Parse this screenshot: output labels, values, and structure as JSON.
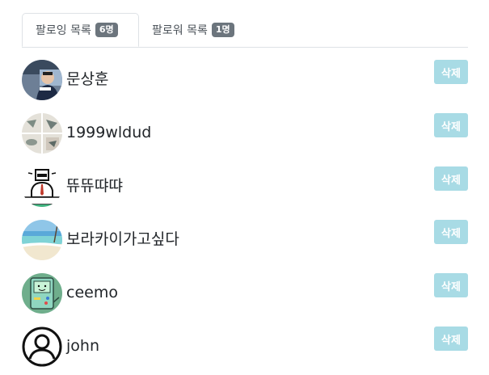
{
  "tabs": [
    {
      "label": "팔로잉 목록",
      "count": "6명"
    },
    {
      "label": "팔로워 목록",
      "count": "1명"
    }
  ],
  "users": [
    {
      "name": "문상훈",
      "avatar": "person-photo",
      "delete_label": "삭제"
    },
    {
      "name": "1999wldud",
      "avatar": "sketch-photo",
      "delete_label": "삭제"
    },
    {
      "name": "뜌뜌땨땨",
      "avatar": "newbie-cartoon",
      "delete_label": "삭제"
    },
    {
      "name": "보라카이가고싶다",
      "avatar": "beach-photo",
      "delete_label": "삭제"
    },
    {
      "name": "ceemo",
      "avatar": "bmo-cartoon",
      "delete_label": "삭제"
    },
    {
      "name": "john",
      "avatar": "default-user-icon",
      "delete_label": "삭제"
    }
  ],
  "colors": {
    "delete_button": "#a8dbe5",
    "badge": "#6c757d"
  }
}
